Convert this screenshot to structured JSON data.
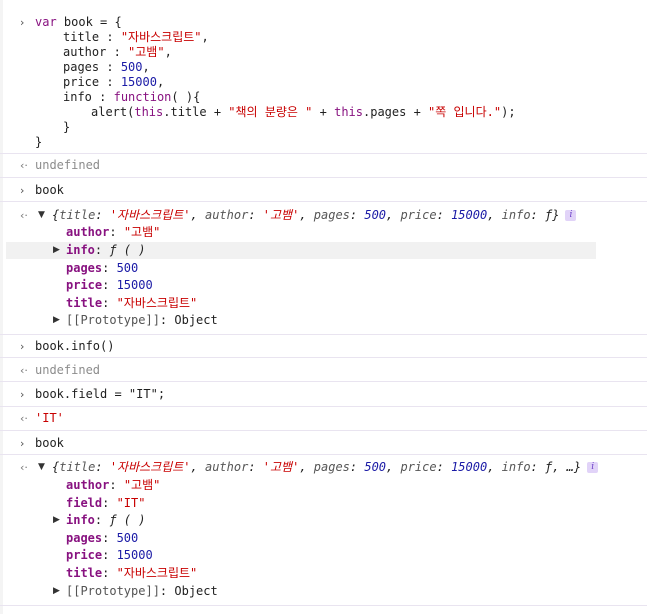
{
  "code": {
    "l1": [
      "var",
      " book = {"
    ],
    "l2": [
      "title",
      " : ",
      "\"자바스크립트\"",
      ","
    ],
    "l3": [
      "author",
      " : ",
      "\"고뱀\"",
      ","
    ],
    "l4": [
      "pages",
      " : ",
      "500",
      ","
    ],
    "l5": [
      "price",
      " : ",
      "15000",
      ","
    ],
    "l6": [
      "info",
      " : ",
      "function",
      "( ){"
    ],
    "l7": [
      "alert(",
      "this",
      ".title + ",
      "\"책의 분량은 \"",
      " + ",
      "this",
      ".pages + ",
      "\"쪽 입니다.\"",
      ");"
    ],
    "l8": "}",
    "l9": "}"
  },
  "entries": {
    "undefined1": "undefined",
    "book1": "book",
    "bookinfo": "book.info()",
    "undefined2": "undefined",
    "assign": "book.field = \"IT\";",
    "it_result": "'IT'",
    "book2": "book"
  },
  "obj1": {
    "preview": [
      "{",
      "title",
      ": ",
      "'자바스크립트'",
      ", ",
      "author",
      ": ",
      "'고뱀'",
      ", ",
      "pages",
      ": ",
      "500",
      ", ",
      "price",
      ": ",
      "15000",
      ", ",
      "info",
      ": ",
      "ƒ",
      "}"
    ],
    "props": [
      {
        "key": "author",
        "sep": ": ",
        "val": "\"고뱀\""
      },
      {
        "key": "info",
        "sep": ": ",
        "val": "ƒ ( )"
      },
      {
        "key": "pages",
        "sep": ": ",
        "val": "500"
      },
      {
        "key": "price",
        "sep": ": ",
        "val": "15000"
      },
      {
        "key": "title",
        "sep": ": ",
        "val": "\"자바스크립트\""
      }
    ],
    "proto_key": "[[Prototype]]",
    "proto_val": ": Object"
  },
  "obj2": {
    "preview": [
      "{",
      "title",
      ": ",
      "'자바스크립트'",
      ", ",
      "author",
      ": ",
      "'고뱀'",
      ", ",
      "pages",
      ": ",
      "500",
      ", ",
      "price",
      ": ",
      "15000",
      ", ",
      "info",
      ": ",
      "ƒ",
      ", …}"
    ],
    "props": [
      {
        "key": "author",
        "sep": ": ",
        "val": "\"고뱀\""
      },
      {
        "key": "field",
        "sep": ": ",
        "val": "\"IT\""
      },
      {
        "key": "info",
        "sep": ": ",
        "val": "ƒ ( )"
      },
      {
        "key": "pages",
        "sep": ": ",
        "val": "500"
      },
      {
        "key": "price",
        "sep": ": ",
        "val": "15000"
      },
      {
        "key": "title",
        "sep": ": ",
        "val": "\"자바스크립트\""
      }
    ],
    "proto_key": "[[Prototype]]",
    "proto_val": ": Object"
  },
  "icons": {
    "prompt": "›",
    "return": "‹·",
    "collapse": "▼",
    "expand": "▶",
    "info_badge": "i"
  },
  "colors": {
    "keyword": "#881280",
    "string": "#c80000",
    "number": "#1a1aa6"
  }
}
